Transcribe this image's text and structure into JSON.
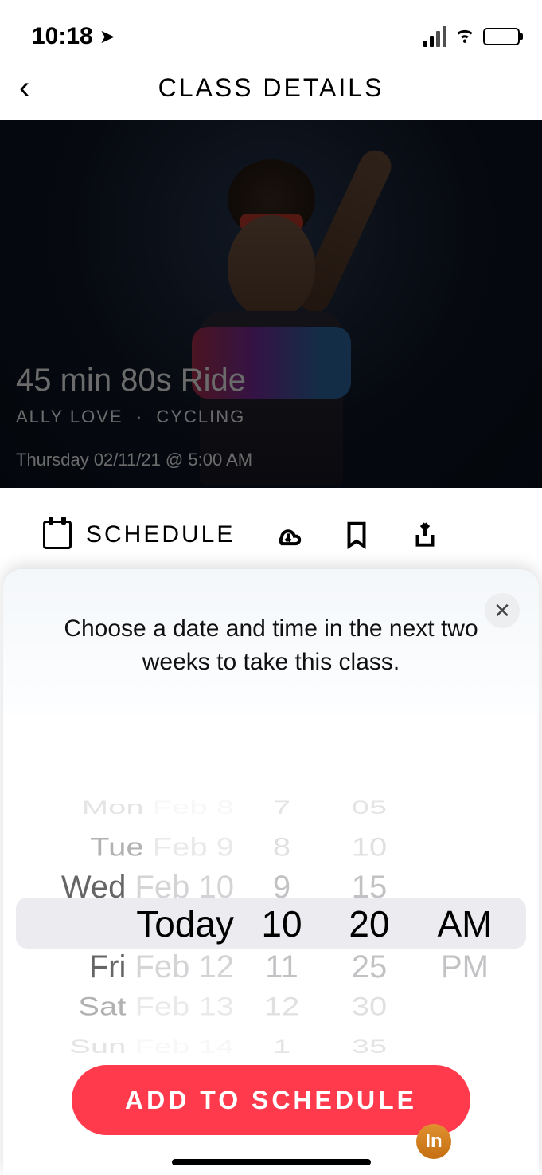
{
  "status": {
    "time": "10:18"
  },
  "nav": {
    "title": "CLASS DETAILS"
  },
  "hero": {
    "title": "45 min 80s Ride",
    "instructor": "ALLY LOVE",
    "dot": "·",
    "category": "CYCLING",
    "datetime": "Thursday 02/11/21 @ 5:00 AM"
  },
  "actions": {
    "schedule_label": "SCHEDULE"
  },
  "sheet": {
    "message": "Choose a date and time in the next two weeks to take this class.",
    "close_glyph": "✕",
    "cta": "ADD TO SCHEDULE"
  },
  "picker": {
    "rows": [
      {
        "off": -3,
        "day": "Mon",
        "date": "Feb 8",
        "hr": "7",
        "min": "05",
        "ap": ""
      },
      {
        "off": -2,
        "day": "Tue",
        "date": "Feb 9",
        "hr": "8",
        "min": "10",
        "ap": ""
      },
      {
        "off": -1,
        "day": "Wed",
        "date": "Feb 10",
        "hr": "9",
        "min": "15",
        "ap": ""
      },
      {
        "off": 0,
        "day": "Today",
        "date": "",
        "hr": "10",
        "min": "20",
        "ap": "AM"
      },
      {
        "off": 1,
        "day": "Fri",
        "date": "Feb 12",
        "hr": "11",
        "min": "25",
        "ap": "PM"
      },
      {
        "off": 2,
        "day": "Sat",
        "date": "Feb 13",
        "hr": "12",
        "min": "30",
        "ap": ""
      },
      {
        "off": 3,
        "day": "Sun",
        "date": "Feb 14",
        "hr": "1",
        "min": "35",
        "ap": ""
      }
    ]
  },
  "badge": {
    "text": "In"
  }
}
